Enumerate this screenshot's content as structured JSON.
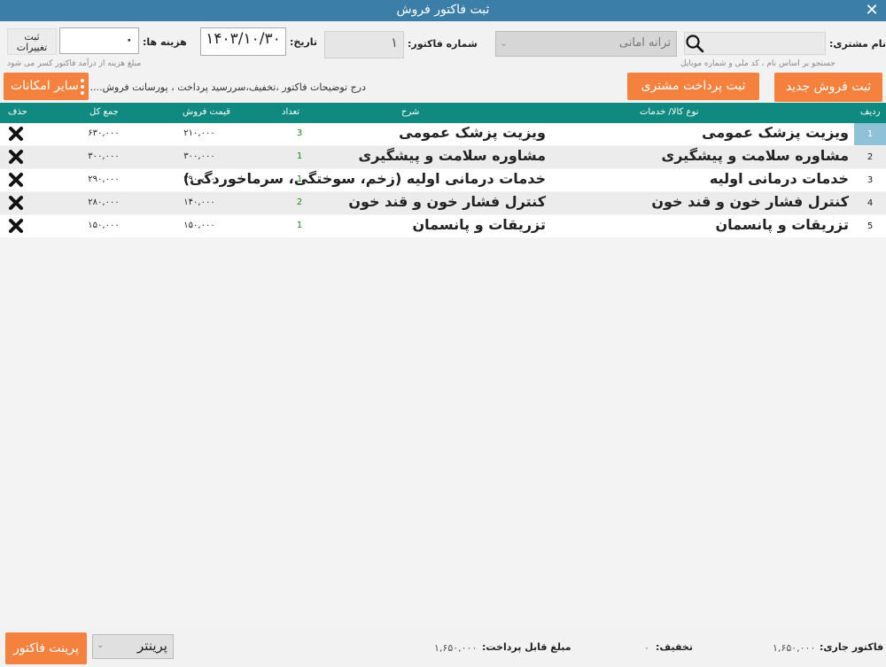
{
  "window": {
    "title": "ثبت فاکتور فروش",
    "close": "✕"
  },
  "customer": {
    "label": "نام مشتری:",
    "selected": "ترانه امانی",
    "hint": "جستجو بر اساس نام ، کد ملی و شماره موبایل"
  },
  "invoice": {
    "number_label": "شماره فاکتور:",
    "number": "۱",
    "date_label": "تاریخ:",
    "date": "۱۴۰۳/۱۰/۳۰",
    "cost_label": "هزینه ها:",
    "cost": "۰",
    "cost_hint": "مبلغ هزینه از درآمد فاکتور کسر می شود",
    "save_changes_line1": "ثبت",
    "save_changes_line2": "تغییرات"
  },
  "actions": {
    "new_sale": "ثبت فروش جدید",
    "customer_payment": "ثبت پرداخت مشتری",
    "more": "سایر امکانات",
    "description_hint": "درج توضیحات فاکتور ،تخفیف،سررسید پرداخت ، پورسانت فروش...."
  },
  "table": {
    "headers": {
      "index": "ردیف",
      "item": "نوع کالا/ خدمات",
      "description": "شرح",
      "qty": "تعداد",
      "price": "قیمت فروش",
      "total": "جمع کل",
      "delete": "حذف"
    },
    "rows": [
      {
        "index": "1",
        "item": "ویزیت پزشک عمومی",
        "description": "ویزیت پزشک عمومی",
        "qty": "3",
        "price": "۲۱۰,۰۰۰",
        "total": "۶۳۰,۰۰۰"
      },
      {
        "index": "2",
        "item": "مشاوره سلامت و پیشگیری",
        "description": "مشاوره سلامت و پیشگیری",
        "qty": "1",
        "price": "۳۰۰,۰۰۰",
        "total": "۳۰۰,۰۰۰"
      },
      {
        "index": "3",
        "item": "خدمات درمانی اولیه",
        "description": "خدمات درمانی اولیه (زخم، سوختگی، سرماخوردگی)",
        "qty": "1",
        "price": "۲۹۰,۰۰۰",
        "total": "۲۹۰,۰۰۰"
      },
      {
        "index": "4",
        "item": "کنترل فشار خون و قند خون",
        "description": "کنترل فشار خون و قند خون",
        "qty": "2",
        "price": "۱۴۰,۰۰۰",
        "total": "۲۸۰,۰۰۰"
      },
      {
        "index": "5",
        "item": "تزریقات و پانسمان",
        "description": "تزریقات و پانسمان",
        "qty": "1",
        "price": "۱۵۰,۰۰۰",
        "total": "۱۵۰,۰۰۰"
      }
    ]
  },
  "footer": {
    "current_invoice_label": "فاکتور جاری:",
    "current_invoice": "۱,۶۵۰,۰۰۰",
    "discount_label": "تخفیف:",
    "discount": "۰",
    "payable_label": "مبلغ قابل پرداخت:",
    "payable": "۱,۶۵۰,۰۰۰",
    "printer": "پرینتر",
    "print_button": "پرینت فاکتور"
  },
  "colors": {
    "titlebar": "#3b7fa8",
    "header": "#108a80",
    "accent": "#f5813e"
  },
  "icons": {
    "search": "search-icon",
    "delete": "delete-x-icon",
    "dropdown": "chevron-down-icon",
    "more": "vertical-dots-icon"
  }
}
